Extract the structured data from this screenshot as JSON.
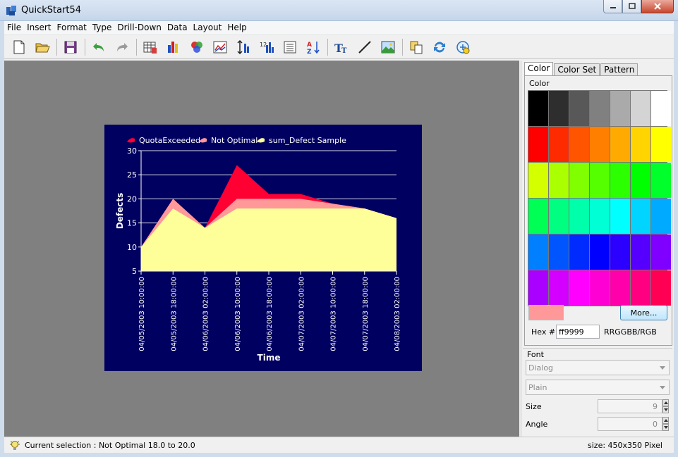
{
  "window": {
    "title": "QuickStart54"
  },
  "menu": [
    "File",
    "Insert",
    "Format",
    "Type",
    "Drill-Down",
    "Data",
    "Layout",
    "Help"
  ],
  "toolbar": {
    "icons": [
      "new-file-icon",
      "open-folder-icon",
      "save-icon",
      "undo-icon",
      "redo-icon",
      "data-table-icon",
      "chart-type-icon",
      "color-palette-icon",
      "line-chart-icon",
      "axis-scale-icon",
      "bar-data-icon",
      "list-icon",
      "sort-az-icon",
      "text-tool-icon",
      "line-tool-icon",
      "image-tool-icon",
      "copy-icon",
      "refresh-icon",
      "zoom-icon"
    ]
  },
  "chart_data": {
    "type": "area",
    "title": "",
    "xlabel": "Time",
    "ylabel": "Defects",
    "ylim": [
      5,
      30
    ],
    "yticks": [
      "5",
      "10",
      "15",
      "20",
      "25",
      "30"
    ],
    "grid": true,
    "legend_position": "top",
    "background": "#000060",
    "x": [
      "04/05/2003 10:00:00",
      "04/05/2003 18:00:00",
      "04/06/2003 02:00:00",
      "04/06/2003 10:00:00",
      "04/06/2003 18:00:00",
      "04/07/2003 02:00:00",
      "04/07/2003 10:00:00",
      "04/07/2003 18:00:00",
      "04/08/2003 02:00:00"
    ],
    "series": [
      {
        "name": "QuotaExceeded",
        "color": "#ff0033",
        "values": [
          10,
          20,
          14,
          27,
          21,
          21,
          19,
          18,
          16
        ]
      },
      {
        "name": "Not Optimal",
        "color": "#ff9999",
        "values": [
          10,
          20,
          14,
          20,
          20,
          20,
          19,
          18,
          16
        ]
      },
      {
        "name": "sum_Defect Sample",
        "color": "#ffff99",
        "values": [
          10,
          18,
          14,
          18,
          18,
          18,
          18,
          18,
          16
        ]
      }
    ]
  },
  "panel": {
    "tabs": [
      "Color",
      "Color Set",
      "Pattern"
    ],
    "color_group_label": "Color",
    "swatches": [
      "#000000",
      "#2e2e2e",
      "#585858",
      "#808080",
      "#aaaaaa",
      "#d4d4d4",
      "#ffffff",
      "#ff0000",
      "#ff2b00",
      "#ff5500",
      "#ff8000",
      "#ffaa00",
      "#ffd400",
      "#ffff00",
      "#d4ff00",
      "#aaff00",
      "#80ff00",
      "#55ff00",
      "#2bff00",
      "#00ff00",
      "#00ff2b",
      "#00ff55",
      "#00ff80",
      "#00ffaa",
      "#00ffd4",
      "#00ffff",
      "#00d4ff",
      "#00aaff",
      "#0080ff",
      "#0055ff",
      "#002bff",
      "#0000ff",
      "#2b00ff",
      "#5500ff",
      "#8000ff",
      "#aa00ff",
      "#d400ff",
      "#ff00ff",
      "#ff00d4",
      "#ff00aa",
      "#ff0080",
      "#ff0055"
    ],
    "current_color": "#ff9999",
    "more_label": "More...",
    "hex_label": "Hex #",
    "hex_value": "ff9999",
    "hex_format": "RRGGBB/RGB",
    "font": {
      "section_label": "Font",
      "family": "Dialog",
      "style": "Plain",
      "size_label": "Size",
      "size_value": "9",
      "angle_label": "Angle",
      "angle_value": "0"
    }
  },
  "status": {
    "selection_text": "Current selection : Not Optimal 18.0 to 20.0",
    "size_text": "size: 450x350 Pixel"
  }
}
